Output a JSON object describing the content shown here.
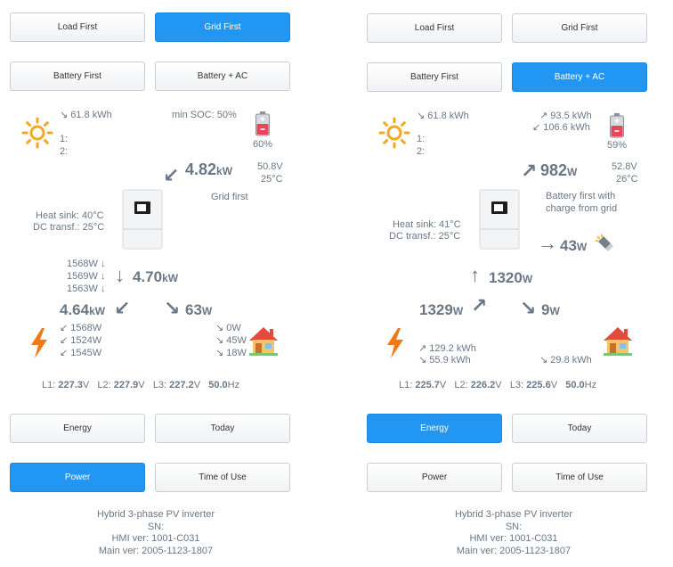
{
  "left": {
    "buttons": {
      "load_first": "Load First",
      "grid_first": "Grid First",
      "battery_first": "Battery First",
      "battery_ac": "Battery + AC",
      "energy": "Energy",
      "today": "Today",
      "power": "Power",
      "time_of_use": "Time of Use"
    },
    "active_buttons": [
      "Grid First",
      "Power"
    ],
    "pv": {
      "energy": "↘ 61.8 kWh",
      "string1": "1:",
      "string2": "2:"
    },
    "battery": {
      "min_soc": "min SOC: 50%",
      "percent": "60%",
      "voltage": "50.8V",
      "temp": "25°C",
      "level": 0.6
    },
    "flow_in": {
      "value": "4.82",
      "unit": "kW"
    },
    "mode_text": "Grid first",
    "inverter": {
      "heat_sink": "Heat sink: 40°C",
      "dc_transf": "DC transf.: 25°C"
    },
    "phase_power": [
      "1568W ↓",
      "1569W ↓",
      "1563W ↓"
    ],
    "inverter_out": {
      "value": "4.70",
      "unit": "kW"
    },
    "grid": {
      "value": "4.64",
      "unit": "kW",
      "phases": [
        "↙ 1568W",
        "↙ 1524W",
        "↙ 1545W"
      ]
    },
    "load": {
      "value": "63",
      "unit": "W",
      "phases": [
        "↘ 0W",
        "↘ 45W",
        "↘ 18W"
      ]
    },
    "voltages": {
      "l1_label": "L1:",
      "l1": "227.3",
      "l2_label": "L2:",
      "l2": "227.9",
      "l3_label": "L3:",
      "l3": "227.2",
      "v": "V",
      "freq": "50.0",
      "hz": "Hz"
    },
    "footer": [
      "Hybrid 3-phase PV inverter",
      "SN:",
      "HMI ver: 1001-C031",
      "Main ver: 2005-1123-1807"
    ]
  },
  "right": {
    "buttons": {
      "load_first": "Load First",
      "grid_first": "Grid First",
      "battery_first": "Battery First",
      "battery_ac": "Battery + AC",
      "energy": "Energy",
      "today": "Today",
      "power": "Power",
      "time_of_use": "Time of Use"
    },
    "active_buttons": [
      "Battery + AC",
      "Energy"
    ],
    "pv": {
      "energy": "↘ 61.8 kWh",
      "string1": "1:",
      "string2": "2:"
    },
    "battery": {
      "charge": "↗ 93.5 kWh",
      "discharge": "↙ 106.6 kWh",
      "percent": "59%",
      "voltage": "52.8V",
      "temp": "26°C",
      "level": 0.59
    },
    "flow_out": {
      "value": "982",
      "unit": "W"
    },
    "mode_text_1": "Battery first with",
    "mode_text_2": "charge from grid",
    "inverter": {
      "heat_sink": "Heat sink: 41°C",
      "dc_transf": "DC transf.: 25°C"
    },
    "aux": {
      "value": "43",
      "unit": "W"
    },
    "inverter_in": {
      "value": "1320",
      "unit": "W"
    },
    "grid": {
      "value": "1329",
      "unit": "W",
      "import": "↗ 129.2 kWh",
      "export": "↘ 55.9 kWh"
    },
    "load": {
      "value": "9",
      "unit": "W",
      "energy": "↘ 29.8 kWh"
    },
    "voltages": {
      "l1_label": "L1:",
      "l1": "225.7",
      "l2_label": "L2:",
      "l2": "226.2",
      "l3_label": "L3:",
      "l3": "225.6",
      "v": "V",
      "freq": "50.0",
      "hz": "Hz"
    },
    "footer": [
      "Hybrid 3-phase PV inverter",
      "SN:",
      "HMI ver: 1001-C031",
      "Main ver: 2005-1123-1807"
    ]
  },
  "colors": {
    "accent": "#2196f3",
    "text": "#6b7785",
    "sun": "#f5a623",
    "bolt": "#f07a1a",
    "battery_fill": "#e8455a"
  }
}
